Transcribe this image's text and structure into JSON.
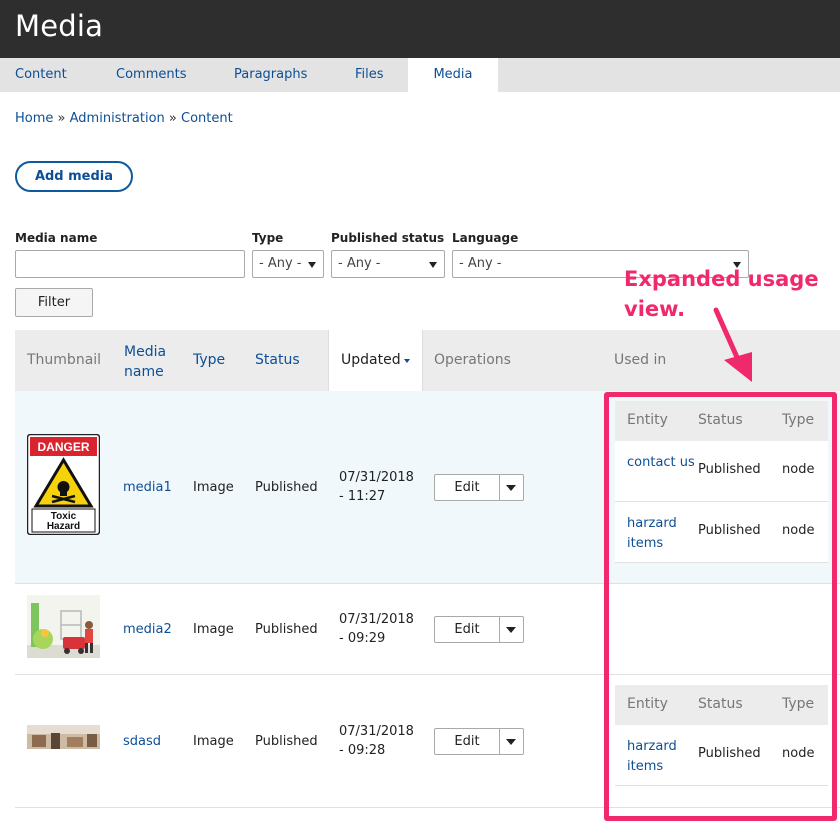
{
  "header": {
    "title": "Media"
  },
  "tabs": [
    {
      "label": "Content"
    },
    {
      "label": "Comments"
    },
    {
      "label": "Paragraphs"
    },
    {
      "label": "Files"
    },
    {
      "label": "Media",
      "active": true
    }
  ],
  "breadcrumb": {
    "items": [
      "Home",
      "Administration",
      "Content"
    ],
    "separator": "»"
  },
  "add_media_label": "Add media",
  "filters": {
    "media_name": {
      "label": "Media name",
      "value": ""
    },
    "type": {
      "label": "Type",
      "value": "- Any -"
    },
    "published_status": {
      "label": "Published status",
      "value": "- Any -"
    },
    "language": {
      "label": "Language",
      "value": "- Any -"
    },
    "filter_button": "Filter"
  },
  "table": {
    "headers": {
      "thumbnail": "Thumbnail",
      "media_name": "Media name",
      "type": "Type",
      "status": "Status",
      "updated": "Updated",
      "operations": "Operations",
      "used_in": "Used in"
    },
    "rows": [
      {
        "thumb_lines": [
          "DANGER",
          "Toxic",
          "Hazard"
        ],
        "name": "media1",
        "type": "Image",
        "status": "Published",
        "updated_date": "07/31/2018",
        "updated_time": "- 11:27",
        "edit_label": "Edit",
        "usage": {
          "headers": {
            "entity": "Entity",
            "status": "Status",
            "type": "Type"
          },
          "rows": [
            {
              "entity": "contact us",
              "status": "Published",
              "type": "node"
            },
            {
              "entity": "harzard items",
              "status": "Published",
              "type": "node"
            }
          ]
        }
      },
      {
        "name": "media2",
        "type": "Image",
        "status": "Published",
        "updated_date": "07/31/2018",
        "updated_time": "- 09:29",
        "edit_label": "Edit"
      },
      {
        "name": "sdasd",
        "type": "Image",
        "status": "Published",
        "updated_date": "07/31/2018",
        "updated_time": "- 09:28",
        "edit_label": "Edit",
        "usage": {
          "headers": {
            "entity": "Entity",
            "status": "Status",
            "type": "Type"
          },
          "rows": [
            {
              "entity": "harzard items",
              "status": "Published",
              "type": "node"
            }
          ]
        }
      }
    ]
  },
  "annotation": {
    "text": "Expanded usage view.",
    "color": "#f0286c"
  },
  "colors": {
    "link": "#0d4f96",
    "header_bg": "#2e2e2e",
    "tabs_bg": "#e3e3e3",
    "row_highlight": "#f1f8fc"
  }
}
